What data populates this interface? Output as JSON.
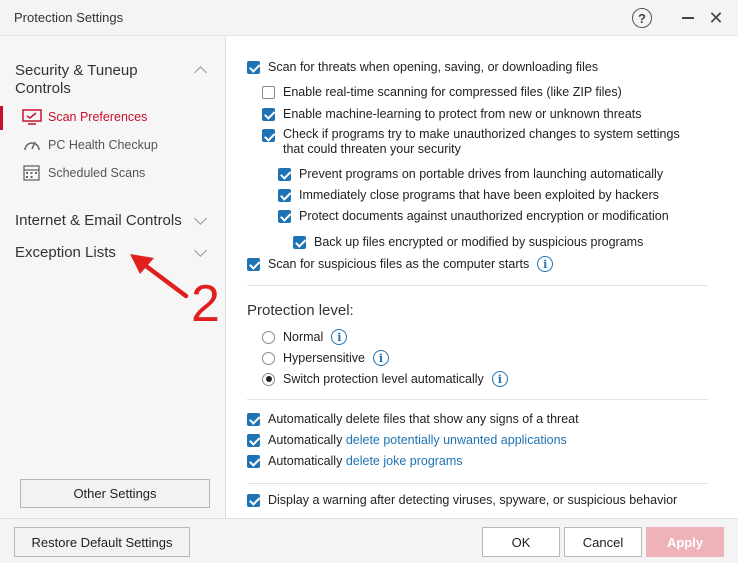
{
  "window": {
    "title": "Protection Settings",
    "help_glyph": "?",
    "close_glyph": "✕"
  },
  "sidebar": {
    "sections": [
      {
        "label": "Security & Tuneup Controls",
        "expanded": true
      },
      {
        "label": "Internet & Email Controls",
        "expanded": false
      },
      {
        "label": "Exception Lists",
        "expanded": false
      }
    ],
    "items": [
      {
        "label": "Scan Preferences",
        "icon": "monitor-icon",
        "active": true
      },
      {
        "label": "PC Health Checkup",
        "icon": "gauge-icon",
        "active": false
      },
      {
        "label": "Scheduled Scans",
        "icon": "calendar-icon",
        "active": false
      }
    ],
    "other_settings": "Other Settings",
    "accent": "#c8102e"
  },
  "annotation": {
    "number": "2",
    "color": "#e0201f"
  },
  "main": {
    "options": [
      {
        "label": "Scan for threats when opening, saving, or downloading files",
        "checked": true
      },
      {
        "label": "Enable real-time scanning for compressed files (like ZIP files)",
        "checked": false
      },
      {
        "label": "Enable machine-learning to protect from new or unknown threats",
        "checked": true
      },
      {
        "label": "Check if programs try to make unauthorized changes to system settings that could threaten your security",
        "checked": true
      },
      {
        "label": "Prevent programs on portable drives from launching automatically",
        "checked": true
      },
      {
        "label": "Immediately close programs that have been exploited by hackers",
        "checked": true
      },
      {
        "label": "Protect documents against unauthorized encryption or modification",
        "checked": true
      },
      {
        "label": "Back up files encrypted or modified by suspicious programs",
        "checked": true
      },
      {
        "label": "Scan for suspicious files as the computer starts",
        "checked": true
      }
    ],
    "protection_level": {
      "label": "Protection level:",
      "options": [
        {
          "label": "Normal",
          "selected": false
        },
        {
          "label": "Hypersensitive",
          "selected": false
        },
        {
          "label": "Switch protection level automatically",
          "selected": true
        }
      ]
    },
    "auto_delete": [
      {
        "label": "Automatically delete files that show any signs of a threat",
        "checked": true
      },
      {
        "prefix": "Automatically ",
        "link": "delete potentially unwanted applications",
        "checked": true
      },
      {
        "prefix": "Automatically ",
        "link": "delete joke programs",
        "checked": true
      }
    ],
    "warning": {
      "label": "Display a warning after detecting viruses, spyware, or suspicious behavior",
      "checked": true
    },
    "info_glyph": "i",
    "checkbox_color": "#1e73b4",
    "link_color": "#1e73b4"
  },
  "footer": {
    "restore": "Restore Default Settings",
    "ok": "OK",
    "cancel": "Cancel",
    "apply": "Apply",
    "apply_enabled": false
  }
}
